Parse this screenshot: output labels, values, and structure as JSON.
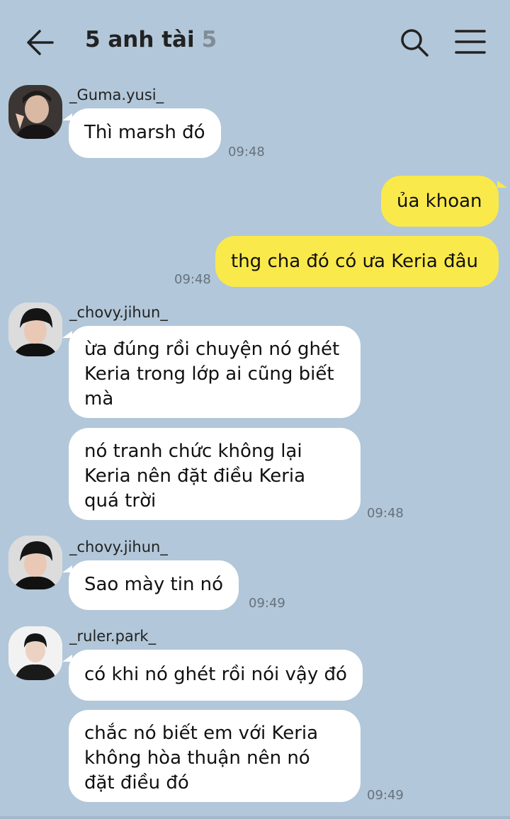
{
  "header": {
    "title": "5 anh tài",
    "member_count": "5",
    "back_icon": "back-arrow-icon",
    "search_icon": "search-icon",
    "menu_icon": "menu-icon"
  },
  "colors": {
    "background": "#b2c7d9",
    "incoming_bubble": "#ffffff",
    "outgoing_bubble": "#fae94a"
  },
  "messages": [
    {
      "sender": "_Guma.yusi_",
      "text": "Thì marsh đó",
      "time": "09:48"
    },
    {
      "sender": "me",
      "text": "ủa khoan"
    },
    {
      "sender": "me",
      "text": "thg cha đó có ưa Keria đâu",
      "time": "09:48"
    },
    {
      "sender": "_chovy.jihun_",
      "lines": [
        "ừa đúng rồi chuyện nó ghét",
        "Keria trong lớp ai cũng biết",
        "mà"
      ]
    },
    {
      "sender": "_chovy.jihun_",
      "lines": [
        "nó tranh chức không lại",
        "Keria nên đặt điều Keria",
        "quá trời"
      ],
      "time": "09:48"
    },
    {
      "sender": "_chovy.jihun_",
      "text": "Sao mày tin nó",
      "time": "09:49"
    },
    {
      "sender": "_ruler.park_",
      "text": "có khi nó ghét rồi nói vậy đó"
    },
    {
      "sender": "_ruler.park_",
      "lines": [
        "chắc nó biết em với Keria",
        "không hòa thuận nên nó",
        "đặt điều đó"
      ],
      "time": "09:49"
    }
  ]
}
